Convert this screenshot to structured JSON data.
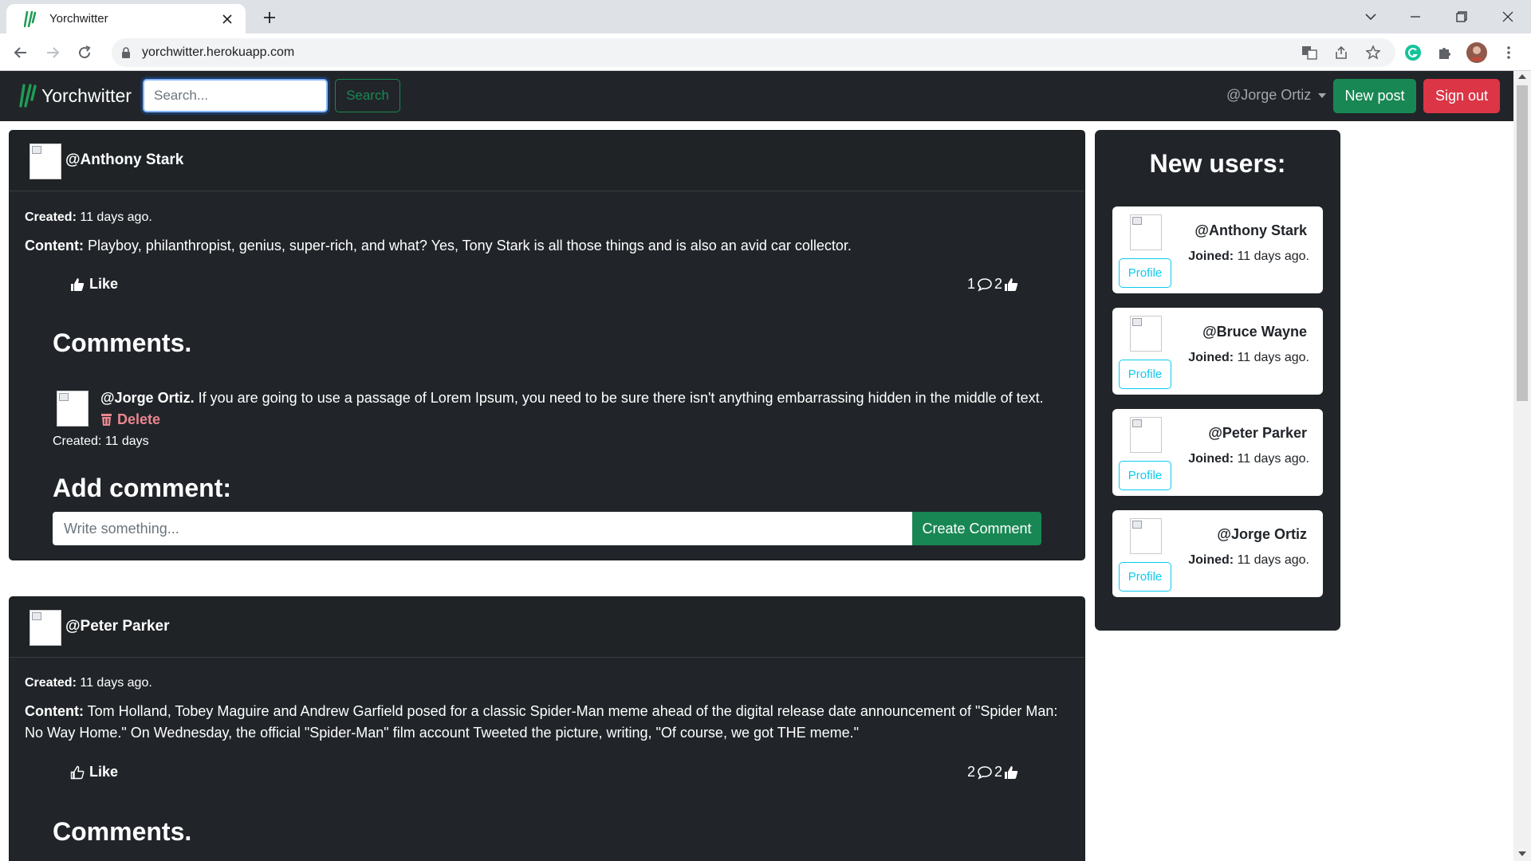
{
  "browser": {
    "tab_title": "Yorchwitter",
    "url": "yorchwitter.herokuapp.com"
  },
  "navbar": {
    "brand": "Yorchwitter",
    "search_placeholder": "Search...",
    "search_button": "Search",
    "user_menu": "@Jorge Ortiz",
    "new_post_button": "New post",
    "sign_out_button": "Sign out"
  },
  "posts": [
    {
      "username": "@Anthony Stark",
      "created_label": "Created:",
      "created_value": "11 days ago.",
      "content_label": "Content:",
      "content_text": "Playboy, philanthropist, genius, super-rich, and what? Yes, Tony Stark is all those things and is also an avid car collector.",
      "like_label": "Like",
      "comment_count": "1",
      "like_count": "2",
      "comments_title": "Comments.",
      "comments": [
        {
          "author": "@Jorge Ortiz.",
          "text": "If you are going to use a passage of Lorem Ipsum, you need to be sure there isn't anything embarrassing hidden in the middle of text.",
          "delete_label": "Delete",
          "created": "Created: 11 days"
        }
      ],
      "add_comment_title": "Add comment:",
      "comment_placeholder": "Write something...",
      "create_comment_button": "Create Comment"
    },
    {
      "username": "@Peter Parker",
      "created_label": "Created:",
      "created_value": "11 days ago.",
      "content_label": "Content:",
      "content_text": "Tom Holland, Tobey Maguire and Andrew Garfield posed for a classic Spider-Man meme ahead of the digital release date announcement of \"Spider Man: No Way Home.\" On Wednesday, the official \"Spider-Man\" film account Tweeted the picture, writing, \"Of course, we got THE meme.\"",
      "like_label": "Like",
      "comment_count": "2",
      "like_count": "2",
      "comments_title": "Comments."
    }
  ],
  "sidebar": {
    "title": "New users:",
    "joined_label": "Joined:",
    "profile_button": "Profile",
    "users": [
      {
        "name": "@Anthony Stark",
        "joined": "11 days ago."
      },
      {
        "name": "@Bruce Wayne",
        "joined": "11 days ago."
      },
      {
        "name": "@Peter Parker",
        "joined": "11 days ago."
      },
      {
        "name": "@Jorge Ortiz",
        "joined": "11 days ago."
      }
    ]
  },
  "colors": {
    "navbar_bg": "#212529",
    "success": "#198754",
    "danger": "#dc3545",
    "info": "#0dcaf0"
  }
}
